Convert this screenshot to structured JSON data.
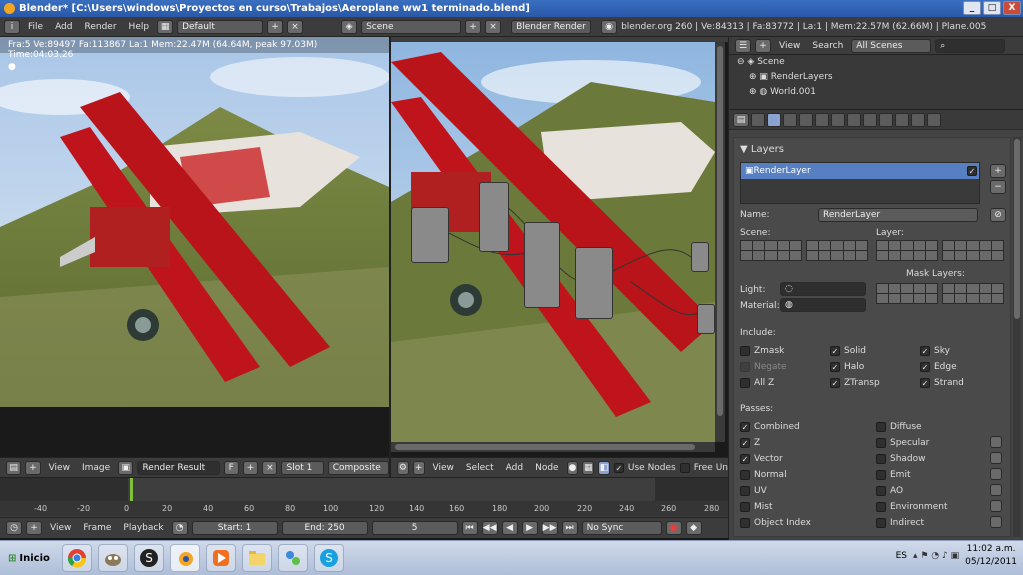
{
  "window": {
    "title": "Blender* [C:\\Users\\windows\\Proyectos en curso\\Trabajos\\Aeroplane ww1 terminado.blend]",
    "buttons": [
      "_",
      "□",
      "X"
    ]
  },
  "topbar": {
    "menus": [
      "File",
      "Add",
      "Render",
      "Help"
    ],
    "layout": "Default",
    "scene": "Scene",
    "engine": "Blender Render",
    "stats": "blender.org 260 | Ve:84313 | Fa:83772 | La:1 | Mem:22.57M (62.66M) | Plane.005"
  },
  "image_editor": {
    "info": "Fra:5  Ve:89497 Fa:113867 La:1 Mem:22.47M (64.64M, peak 97.03M) Time:04:03.26",
    "menus": [
      "View",
      "Image"
    ],
    "image_name": "Render Result",
    "slot": "Slot 1",
    "layer": "Composite"
  },
  "node_editor": {
    "menus": [
      "View",
      "Select",
      "Add",
      "Node"
    ],
    "use_nodes_label": "Use Nodes",
    "free_unused_label": "Free Un"
  },
  "outliner": {
    "menus": [
      "View",
      "Search"
    ],
    "filter": "All Scenes",
    "items": [
      "Scene",
      "RenderLayers",
      "World.001"
    ]
  },
  "layers_panel": {
    "title": "Layers",
    "selected_layer": "RenderLayer",
    "name_label": "Name:",
    "name_value": "RenderLayer",
    "scene_label": "Scene:",
    "layer_label": "Layer:",
    "mask_layers_label": "Mask Layers:",
    "light_label": "Light:",
    "material_label": "Material:",
    "include_label": "Include:",
    "include": [
      {
        "label": "Zmask",
        "checked": false
      },
      {
        "label": "Solid",
        "checked": true
      },
      {
        "label": "Sky",
        "checked": true
      },
      {
        "label": "Negate",
        "checked": false,
        "disabled": true
      },
      {
        "label": "Halo",
        "checked": true
      },
      {
        "label": "Edge",
        "checked": true
      },
      {
        "label": "All Z",
        "checked": false
      },
      {
        "label": "ZTransp",
        "checked": true
      },
      {
        "label": "Strand",
        "checked": true
      }
    ],
    "passes_label": "Passes:",
    "passes_left": [
      {
        "label": "Combined",
        "checked": true
      },
      {
        "label": "Z",
        "checked": true
      },
      {
        "label": "Vector",
        "checked": true
      },
      {
        "label": "Normal",
        "checked": false
      },
      {
        "label": "UV",
        "checked": false
      },
      {
        "label": "Mist",
        "checked": false
      },
      {
        "label": "Object Index",
        "checked": false
      }
    ],
    "passes_right": [
      {
        "label": "Diffuse",
        "checked": false
      },
      {
        "label": "Specular",
        "checked": false
      },
      {
        "label": "Shadow",
        "checked": false
      },
      {
        "label": "Emit",
        "checked": false
      },
      {
        "label": "AO",
        "checked": false
      },
      {
        "label": "Environment",
        "checked": false
      },
      {
        "label": "Indirect",
        "checked": false
      }
    ]
  },
  "timeline": {
    "ticks": [
      "-40",
      "-20",
      "0",
      "20",
      "40",
      "60",
      "80",
      "100",
      "120",
      "140",
      "160",
      "180",
      "200",
      "220",
      "240",
      "260",
      "280"
    ],
    "menus": [
      "View",
      "Frame",
      "Playback"
    ],
    "start": "Start: 1",
    "end": "End: 250",
    "current": "5",
    "sync": "No Sync"
  },
  "taskbar": {
    "start": "Inicio",
    "lang": "ES",
    "time": "11:02 a.m.",
    "date": "05/12/2011"
  },
  "colors": {
    "selected_row": "#5680c2",
    "plane_red": "#c0141c",
    "sky": "#7fa9d6",
    "hill": "#6b7a3a"
  }
}
